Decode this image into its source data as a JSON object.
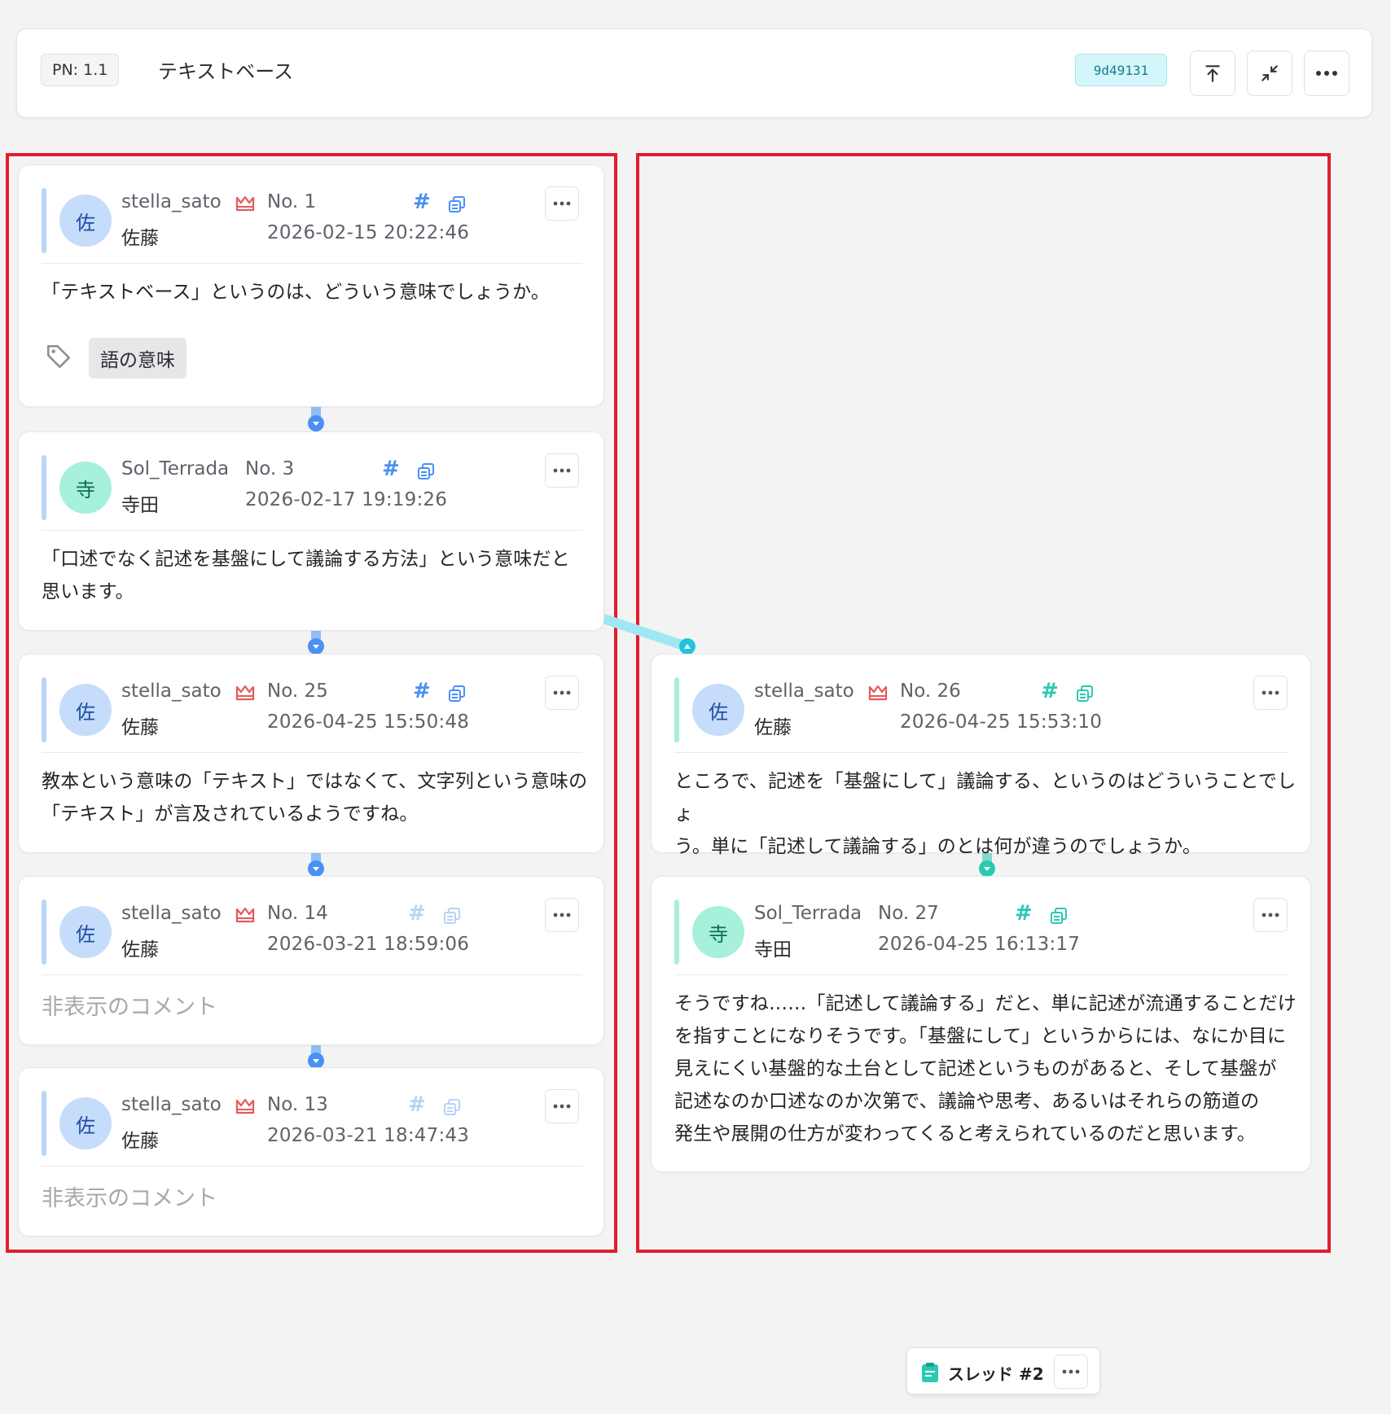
{
  "header": {
    "pn_label": "PN: 1.1",
    "title": "テキストベース",
    "commit": "9d49131",
    "buttons": [
      "scroll-top",
      "collapse",
      "more"
    ]
  },
  "colors": {
    "accent_blue": "#4a90f5",
    "accent_teal": "#2bc9b0",
    "commit_bg": "#d4f6fa",
    "frame_red": "#e01e2d"
  },
  "columns": {
    "left": {
      "posts": [
        {
          "username": "stella_sato",
          "display_name": "佐藤",
          "avatar": "佐",
          "owner": true,
          "no": "No. 1",
          "time": "2026-02-15 20:22:46",
          "text": [
            "「テキストベース」というのは、どういう意味でしょうか。"
          ],
          "tag": "語の意味"
        },
        {
          "username": "Sol_Terrada",
          "display_name": "寺田",
          "avatar": "寺",
          "owner": false,
          "no": "No. 3",
          "time": "2026-02-17 19:19:26",
          "text": [
            "「口述でなく記述を基盤にして議論する方法」という意味だと",
            "思います。"
          ]
        },
        {
          "username": "stella_sato",
          "display_name": "佐藤",
          "avatar": "佐",
          "owner": true,
          "no": "No. 25",
          "time": "2026-04-25 15:50:48",
          "text": [
            "教本という意味の「テキスト」ではなくて、文字列という意味の",
            "「テキスト」が言及されているようですね。"
          ]
        },
        {
          "username": "stella_sato",
          "display_name": "佐藤",
          "avatar": "佐",
          "owner": true,
          "no": "No. 14",
          "time": "2026-03-21 18:59:06",
          "hidden": "非表示のコメント"
        },
        {
          "username": "stella_sato",
          "display_name": "佐藤",
          "avatar": "佐",
          "owner": true,
          "no": "No. 13",
          "time": "2026-03-21 18:47:43",
          "hidden": "非表示のコメント"
        }
      ]
    },
    "right": {
      "posts": [
        {
          "username": "stella_sato",
          "display_name": "佐藤",
          "avatar": "佐",
          "owner": true,
          "no": "No. 26",
          "time": "2026-04-25 15:53:10",
          "text": [
            "ところで、記述を「基盤にして」議論する、というのはどういうことでしょ",
            "う。単に「記述して議論する」のとは何が違うのでしょうか。"
          ]
        },
        {
          "username": "Sol_Terrada",
          "display_name": "寺田",
          "avatar": "寺",
          "owner": false,
          "no": "No. 27",
          "time": "2026-04-25 16:13:17",
          "text": [
            "そうですね……「記述して議論する」だと、単に記述が流通することだけ",
            "を指すことになりそうです。「基盤にして」というからには、なにか目に",
            "見えにくい基盤的な土台として記述というものがあると、そして基盤が",
            "記述なのか口述なのか次第で、議論や思考、あるいはそれらの筋道の",
            "発生や展開の仕方が変わってくると考えられているのだと思います。"
          ]
        }
      ]
    }
  },
  "thread_tab": {
    "label": "スレッド #2"
  }
}
